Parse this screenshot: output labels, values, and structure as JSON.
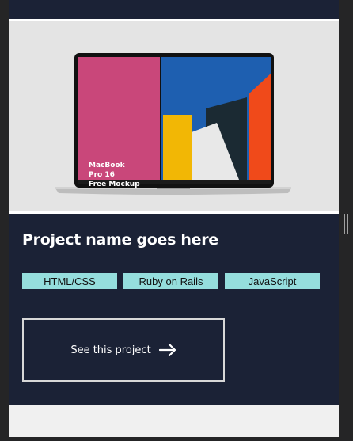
{
  "card": {
    "mockup_text": [
      "MacBook",
      "Pro 16",
      "Free Mockup"
    ],
    "title": "Project name goes here",
    "tags": [
      "HTML/CSS",
      "Ruby on Rails",
      "JavaScript"
    ],
    "cta_label": "See this project",
    "cta_icon": "arrow-right-icon"
  },
  "colors": {
    "card_background": "#1b2236",
    "tag_background": "#95dedd",
    "image_background": "#e4e4e4",
    "next_card_background": "#f0f0f0"
  }
}
